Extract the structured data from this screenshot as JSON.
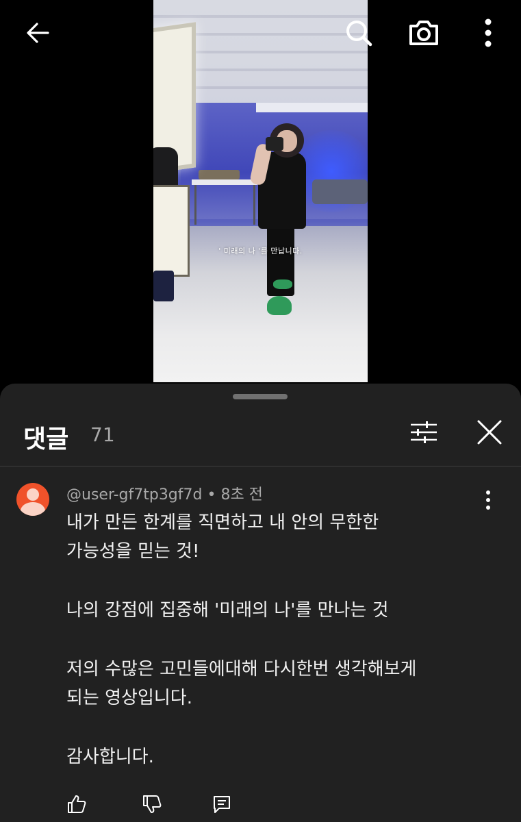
{
  "video": {
    "subtitle": "' 미래의 나 '를 만납니다."
  },
  "top_bar": {
    "icons": [
      "back-arrow-icon",
      "search-icon",
      "camera-icon",
      "more-vert-icon"
    ]
  },
  "comments": {
    "title": "댓글",
    "count": "71",
    "items": [
      {
        "meta": "@user-gf7tp3gf7d • 8초 전",
        "text_lines": [
          "내가 만든 한계를 직면하고 내 안의 무한한",
          "가능성을 믿는 것!",
          "",
          "나의 강점에 집중해 '미래의 나'를 만나는 것",
          "",
          "저의 수많은 고민들에대해 다시한번 생각해보게",
          "되는 영상입니다.",
          "",
          "감사합니다."
        ]
      }
    ]
  },
  "colors": {
    "background": "#000000",
    "sheet": "#212121",
    "avatar": "#f0522a",
    "secondary_text": "#a8a8a8"
  }
}
